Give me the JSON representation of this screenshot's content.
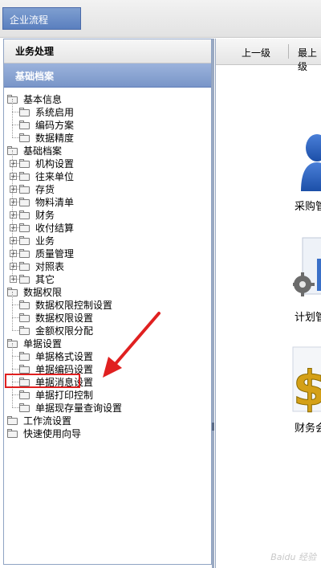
{
  "window": {
    "tab_title": "企业流程"
  },
  "left": {
    "header_business": "业务处理",
    "header_archive": "基础档案",
    "tree": [
      {
        "label": "基本信息",
        "level": 0,
        "folder": "open"
      },
      {
        "label": "系统启用",
        "level": 1
      },
      {
        "label": "编码方案",
        "level": 1
      },
      {
        "label": "数据精度",
        "level": 1
      },
      {
        "label": "基础档案",
        "level": 0,
        "folder": "open"
      },
      {
        "label": "机构设置",
        "level": 1,
        "expander": "+"
      },
      {
        "label": "往来单位",
        "level": 1,
        "expander": "+"
      },
      {
        "label": "存货",
        "level": 1,
        "expander": "+"
      },
      {
        "label": "物料清单",
        "level": 1,
        "expander": "+"
      },
      {
        "label": "财务",
        "level": 1,
        "expander": "+"
      },
      {
        "label": "收付结算",
        "level": 1,
        "expander": "+"
      },
      {
        "label": "业务",
        "level": 1,
        "expander": "+"
      },
      {
        "label": "质量管理",
        "level": 1,
        "expander": "+"
      },
      {
        "label": "对照表",
        "level": 1,
        "expander": "+"
      },
      {
        "label": "其它",
        "level": 1,
        "expander": "+"
      },
      {
        "label": "数据权限",
        "level": 0,
        "folder": "open"
      },
      {
        "label": "数据权限控制设置",
        "level": 1
      },
      {
        "label": "数据权限设置",
        "level": 1
      },
      {
        "label": "金额权限分配",
        "level": 1
      },
      {
        "label": "单据设置",
        "level": 0,
        "folder": "open"
      },
      {
        "label": "单据格式设置",
        "level": 1
      },
      {
        "label": "单据编码设置",
        "level": 1
      },
      {
        "label": "单据消息设置",
        "level": 1
      },
      {
        "label": "单据打印控制",
        "level": 1
      },
      {
        "label": "单据现存量查询设置",
        "level": 1
      },
      {
        "label": "工作流设置",
        "level": 0,
        "folder": "closed"
      },
      {
        "label": "快速使用向导",
        "level": 0,
        "folder": "closed"
      }
    ]
  },
  "right": {
    "toolbar": {
      "up_label": "上一级",
      "top_label": "最上级"
    },
    "modules": [
      {
        "label": "采购管理",
        "icon": "person-icon"
      },
      {
        "label": "计划管理",
        "icon": "gear-chart-icon"
      },
      {
        "label": "财务会计",
        "icon": "dollar-icon"
      }
    ]
  },
  "watermark": "Baidu 经验",
  "colors": {
    "accent": "#6f8fc8",
    "annotation": "#e02020"
  }
}
